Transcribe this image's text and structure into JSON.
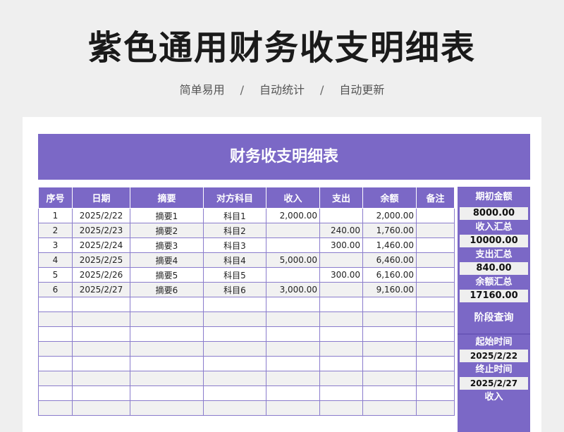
{
  "header": {
    "title": "紫色通用财务收支明细表",
    "tagline": [
      "简单易用",
      "自动统计",
      "自动更新"
    ],
    "separator": "/"
  },
  "sheet": {
    "banner_title": "财务收支明细表",
    "columns": [
      "序号",
      "日期",
      "摘要",
      "对方科目",
      "收入",
      "支出",
      "余额",
      "备注"
    ],
    "rows": [
      {
        "no": "1",
        "date": "2025/2/22",
        "summary": "摘要1",
        "account": "科目1",
        "income": "2,000.00",
        "expense": "",
        "balance": "2,000.00",
        "note": ""
      },
      {
        "no": "2",
        "date": "2025/2/23",
        "summary": "摘要2",
        "account": "科目2",
        "income": "",
        "expense": "240.00",
        "balance": "1,760.00",
        "note": ""
      },
      {
        "no": "3",
        "date": "2025/2/24",
        "summary": "摘要3",
        "account": "科目3",
        "income": "",
        "expense": "300.00",
        "balance": "1,460.00",
        "note": ""
      },
      {
        "no": "4",
        "date": "2025/2/25",
        "summary": "摘要4",
        "account": "科目4",
        "income": "5,000.00",
        "expense": "",
        "balance": "6,460.00",
        "note": ""
      },
      {
        "no": "5",
        "date": "2025/2/26",
        "summary": "摘要5",
        "account": "科目5",
        "income": "",
        "expense": "300.00",
        "balance": "6,160.00",
        "note": ""
      },
      {
        "no": "6",
        "date": "2025/2/27",
        "summary": "摘要6",
        "account": "科目6",
        "income": "3,000.00",
        "expense": "",
        "balance": "9,160.00",
        "note": ""
      }
    ],
    "empty_rows": 8
  },
  "summary_panel": {
    "opening_label": "期初金额",
    "opening_value": "8000.00",
    "income_total_label": "收入汇总",
    "income_total_value": "10000.00",
    "expense_total_label": "支出汇总",
    "expense_total_value": "840.00",
    "balance_total_label": "余额汇总",
    "balance_total_value": "17160.00",
    "query_label": "阶段查询",
    "start_label": "起始时间",
    "start_value": "2025/2/22",
    "end_label": "终止时间",
    "end_value": "2025/2/27",
    "income_label": "收入"
  },
  "colors": {
    "accent": "#7b68c6",
    "row_alt": "#f1f1f1",
    "page_bg": "#efefef"
  }
}
